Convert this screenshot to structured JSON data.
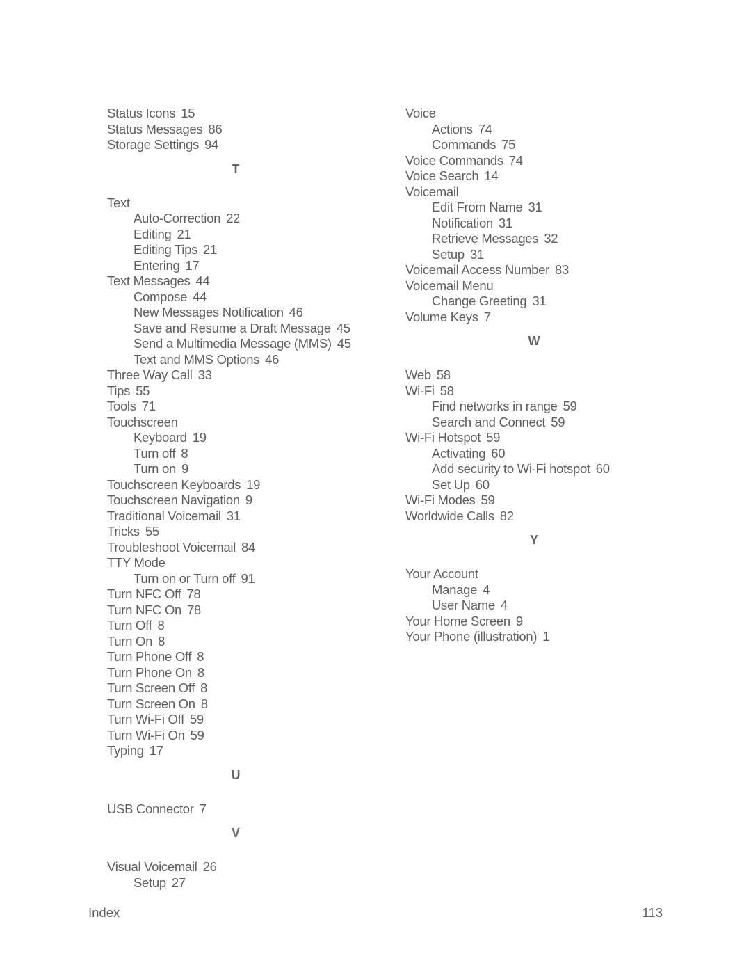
{
  "left_column": [
    {
      "type": "entry",
      "level": 0,
      "term": "Status Icons",
      "page": "15"
    },
    {
      "type": "entry",
      "level": 0,
      "term": "Status Messages",
      "page": "86"
    },
    {
      "type": "entry",
      "level": 0,
      "term": "Storage Settings",
      "page": "94"
    },
    {
      "type": "letter",
      "label": "T"
    },
    {
      "type": "entry",
      "level": 0,
      "term": "Text",
      "page": ""
    },
    {
      "type": "entry",
      "level": 1,
      "term": "Auto-Correction",
      "page": "22"
    },
    {
      "type": "entry",
      "level": 1,
      "term": "Editing",
      "page": "21"
    },
    {
      "type": "entry",
      "level": 1,
      "term": "Editing Tips",
      "page": "21"
    },
    {
      "type": "entry",
      "level": 1,
      "term": "Entering",
      "page": "17"
    },
    {
      "type": "entry",
      "level": 0,
      "term": "Text Messages",
      "page": "44"
    },
    {
      "type": "entry",
      "level": 1,
      "term": "Compose",
      "page": "44"
    },
    {
      "type": "entry",
      "level": 1,
      "term": "New Messages Notification",
      "page": "46"
    },
    {
      "type": "entry",
      "level": 1,
      "term": "Save and Resume a Draft Message",
      "page": "45"
    },
    {
      "type": "entry",
      "level": 1,
      "term": "Send a Multimedia Message (MMS)",
      "page": "45"
    },
    {
      "type": "entry",
      "level": 1,
      "term": "Text and MMS Options",
      "page": "46"
    },
    {
      "type": "entry",
      "level": 0,
      "term": "Three Way Call",
      "page": "33"
    },
    {
      "type": "entry",
      "level": 0,
      "term": "Tips",
      "page": "55"
    },
    {
      "type": "entry",
      "level": 0,
      "term": "Tools",
      "page": "71"
    },
    {
      "type": "entry",
      "level": 0,
      "term": "Touchscreen",
      "page": ""
    },
    {
      "type": "entry",
      "level": 1,
      "term": "Keyboard",
      "page": "19"
    },
    {
      "type": "entry",
      "level": 1,
      "term": "Turn off",
      "page": "8"
    },
    {
      "type": "entry",
      "level": 1,
      "term": "Turn on",
      "page": "9"
    },
    {
      "type": "entry",
      "level": 0,
      "term": "Touchscreen Keyboards",
      "page": "19"
    },
    {
      "type": "entry",
      "level": 0,
      "term": "Touchscreen Navigation",
      "page": "9"
    },
    {
      "type": "entry",
      "level": 0,
      "term": "Traditional Voicemail",
      "page": "31"
    },
    {
      "type": "entry",
      "level": 0,
      "term": "Tricks",
      "page": "55"
    },
    {
      "type": "entry",
      "level": 0,
      "term": "Troubleshoot Voicemail",
      "page": "84"
    },
    {
      "type": "entry",
      "level": 0,
      "term": "TTY Mode",
      "page": ""
    },
    {
      "type": "entry",
      "level": 1,
      "term": "Turn on or Turn off",
      "page": "91"
    },
    {
      "type": "entry",
      "level": 0,
      "term": "Turn NFC Off",
      "page": "78"
    },
    {
      "type": "entry",
      "level": 0,
      "term": "Turn NFC On",
      "page": "78"
    },
    {
      "type": "entry",
      "level": 0,
      "term": "Turn Off",
      "page": "8"
    },
    {
      "type": "entry",
      "level": 0,
      "term": "Turn On",
      "page": "8"
    },
    {
      "type": "entry",
      "level": 0,
      "term": "Turn Phone Off",
      "page": "8"
    },
    {
      "type": "entry",
      "level": 0,
      "term": "Turn Phone On",
      "page": "8"
    },
    {
      "type": "entry",
      "level": 0,
      "term": "Turn Screen Off",
      "page": "8"
    },
    {
      "type": "entry",
      "level": 0,
      "term": "Turn Screen On",
      "page": "8"
    },
    {
      "type": "entry",
      "level": 0,
      "term": "Turn Wi-Fi Off",
      "page": "59"
    },
    {
      "type": "entry",
      "level": 0,
      "term": "Turn Wi-Fi On",
      "page": "59"
    },
    {
      "type": "entry",
      "level": 0,
      "term": "Typing",
      "page": "17"
    },
    {
      "type": "letter",
      "label": "U"
    },
    {
      "type": "entry",
      "level": 0,
      "term": "USB Connector",
      "page": "7"
    },
    {
      "type": "letter",
      "label": "V"
    },
    {
      "type": "entry",
      "level": 0,
      "term": "Visual Voicemail",
      "page": "26"
    },
    {
      "type": "entry",
      "level": 1,
      "term": "Setup",
      "page": "27"
    }
  ],
  "right_column": [
    {
      "type": "entry",
      "level": 0,
      "term": "Voice",
      "page": ""
    },
    {
      "type": "entry",
      "level": 1,
      "term": "Actions",
      "page": "74"
    },
    {
      "type": "entry",
      "level": 1,
      "term": "Commands",
      "page": "75"
    },
    {
      "type": "entry",
      "level": 0,
      "term": "Voice Commands",
      "page": "74"
    },
    {
      "type": "entry",
      "level": 0,
      "term": "Voice Search",
      "page": "14"
    },
    {
      "type": "entry",
      "level": 0,
      "term": "Voicemail",
      "page": ""
    },
    {
      "type": "entry",
      "level": 1,
      "term": "Edit From Name",
      "page": "31"
    },
    {
      "type": "entry",
      "level": 1,
      "term": "Notification",
      "page": "31"
    },
    {
      "type": "entry",
      "level": 1,
      "term": "Retrieve Messages",
      "page": "32"
    },
    {
      "type": "entry",
      "level": 1,
      "term": "Setup",
      "page": "31"
    },
    {
      "type": "entry",
      "level": 0,
      "term": "Voicemail Access Number",
      "page": "83"
    },
    {
      "type": "entry",
      "level": 0,
      "term": "Voicemail Menu",
      "page": ""
    },
    {
      "type": "entry",
      "level": 1,
      "term": "Change Greeting",
      "page": "31"
    },
    {
      "type": "entry",
      "level": 0,
      "term": "Volume Keys",
      "page": "7"
    },
    {
      "type": "letter",
      "label": "W"
    },
    {
      "type": "entry",
      "level": 0,
      "term": "Web",
      "page": "58"
    },
    {
      "type": "entry",
      "level": 0,
      "term": "Wi-Fi",
      "page": "58"
    },
    {
      "type": "entry",
      "level": 1,
      "term": "Find networks in range",
      "page": "59"
    },
    {
      "type": "entry",
      "level": 1,
      "term": "Search and Connect",
      "page": "59"
    },
    {
      "type": "entry",
      "level": 0,
      "term": "Wi-Fi Hotspot",
      "page": "59"
    },
    {
      "type": "entry",
      "level": 1,
      "term": "Activating",
      "page": "60"
    },
    {
      "type": "entry",
      "level": 1,
      "term": "Add security to Wi-Fi hotspot",
      "page": "60"
    },
    {
      "type": "entry",
      "level": 1,
      "term": "Set Up",
      "page": "60"
    },
    {
      "type": "entry",
      "level": 0,
      "term": "Wi-Fi Modes",
      "page": "59"
    },
    {
      "type": "entry",
      "level": 0,
      "term": "Worldwide Calls",
      "page": "82"
    },
    {
      "type": "letter",
      "label": "Y"
    },
    {
      "type": "entry",
      "level": 0,
      "term": "Your Account",
      "page": ""
    },
    {
      "type": "entry",
      "level": 1,
      "term": "Manage",
      "page": "4"
    },
    {
      "type": "entry",
      "level": 1,
      "term": "User Name",
      "page": "4"
    },
    {
      "type": "entry",
      "level": 0,
      "term": "Your Home Screen",
      "page": "9"
    },
    {
      "type": "entry",
      "level": 0,
      "term": "Your Phone (illustration)",
      "page": "1"
    }
  ],
  "footer": {
    "section": "Index",
    "page_number": "113"
  }
}
